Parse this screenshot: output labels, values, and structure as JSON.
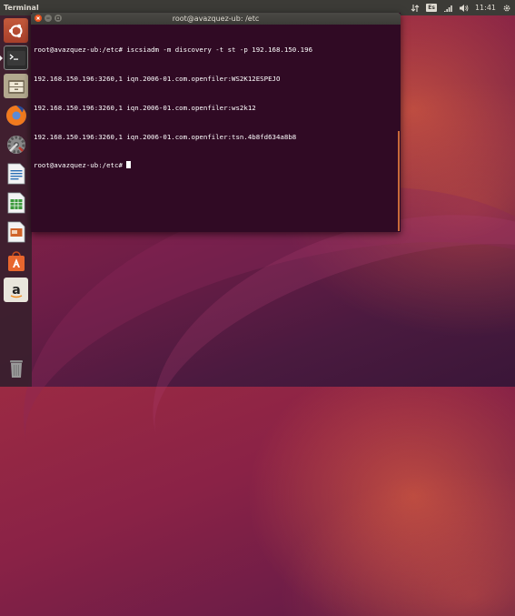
{
  "top_panel": {
    "app_title": "Terminal",
    "keyboard_layout": "Es",
    "clock": "11:41",
    "icons": [
      "transfer-icon",
      "keyboard-layout-indicator",
      "network-icon",
      "volume-icon",
      "settings-gear-icon"
    ]
  },
  "launcher": {
    "items": [
      {
        "name": "ubuntu-dash",
        "label": "Search your computer"
      },
      {
        "name": "terminal",
        "label": "Terminal"
      },
      {
        "name": "files",
        "label": "Files"
      },
      {
        "name": "firefox",
        "label": "Firefox Web Browser"
      },
      {
        "name": "system-settings",
        "label": "System Settings"
      },
      {
        "name": "libreoffice-writer",
        "label": "LibreOffice Writer"
      },
      {
        "name": "libreoffice-calc",
        "label": "LibreOffice Calc"
      },
      {
        "name": "libreoffice-impress",
        "label": "LibreOffice Impress"
      },
      {
        "name": "ubuntu-software",
        "label": "Ubuntu Software"
      },
      {
        "name": "amazon",
        "label": "Amazon"
      },
      {
        "name": "trash",
        "label": "Trash"
      }
    ]
  },
  "window": {
    "title": "root@avazquez-ub: /etc",
    "lines": [
      "root@avazquez-ub:/etc# iscsiadm -m discovery -t st -p 192.168.150.196",
      "192.168.150.196:3260,1 iqn.2006-01.com.openfiler:WS2K12ESPEJO",
      "192.168.150.196:3260,1 iqn.2006-01.com.openfiler:ws2k12",
      "192.168.150.196:3260,1 iqn.2006-01.com.openfiler:tsn.4b8fd634a8b8"
    ],
    "prompt": "root@avazquez-ub:/etc# "
  },
  "colors": {
    "terminal_bg": "#300a24",
    "panel_bg": "#3c3b37",
    "close_button": "#e95420"
  }
}
